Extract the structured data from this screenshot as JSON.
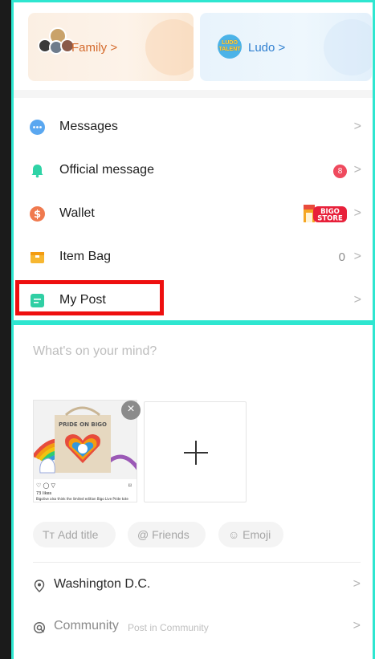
{
  "cards": {
    "family_label": "Family >",
    "ludo_label": "Ludo >",
    "ludo_icon_text_1": "LUDO",
    "ludo_icon_text_2": "TALENT"
  },
  "menu": [
    {
      "label": "Messages",
      "icon": "chat-bubble-icon",
      "color": "#5aa7f0"
    },
    {
      "label": "Official message",
      "icon": "bell-icon",
      "color": "#2fd3a6",
      "badge": "8"
    },
    {
      "label": "Wallet",
      "icon": "dollar-icon",
      "color": "#f07a4f",
      "store_text_1": "BIGO",
      "store_text_2": "STORE"
    },
    {
      "label": "Item Bag",
      "icon": "package-icon",
      "color": "#f7b731",
      "count": "0"
    },
    {
      "label": "My Post",
      "icon": "post-icon",
      "color": "#30cfa4"
    }
  ],
  "chevron": ">",
  "compose": {
    "placeholder": "What's on your mind?",
    "close_symbol": "×",
    "chips": {
      "title": "Tт Add title",
      "friends": "@ Friends",
      "emoji": "☺ Emoji"
    },
    "location": "Washington D.C.",
    "community": "Community",
    "community_sub": "Post in Community"
  },
  "thumb": {
    "banner_text": "PRIDE ON BIGO",
    "likes": "73 likes",
    "caption": "Bigolive also think the limited edition Bigo Live Pride tote"
  },
  "colors": {
    "panel_border": "#2ee6d0",
    "highlight": "#ee0f0f"
  }
}
